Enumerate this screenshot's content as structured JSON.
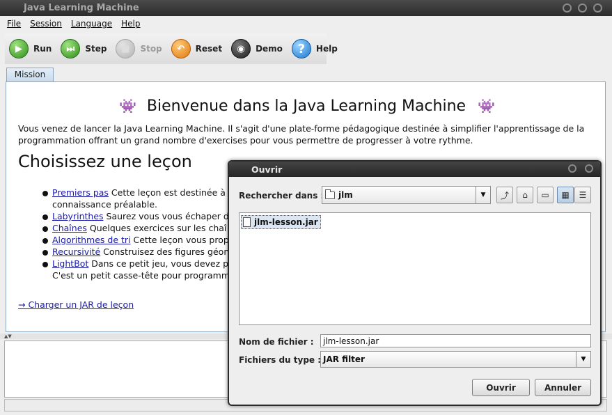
{
  "window": {
    "title": "Java Learning Machine"
  },
  "menu": [
    {
      "label": "File",
      "mnemonic": "F"
    },
    {
      "label": "Session",
      "mnemonic": "S"
    },
    {
      "label": "Language",
      "mnemonic": "L"
    },
    {
      "label": "Help",
      "mnemonic": "H"
    }
  ],
  "toolbar": {
    "run": "Run",
    "step": "Step",
    "stop": "Stop",
    "reset": "Reset",
    "demo": "Demo",
    "help": "Help"
  },
  "tabs": {
    "mission": "Mission"
  },
  "mission": {
    "welcome": "Bienvenue dans la Java Learning Machine",
    "intro": "Vous venez de lancer la Java Learning Machine. Il s'agit d'une plate-forme pédagogique destinée à simplifier l'apprentissage de la programmation offrant un grand nombre d'exercises pour vous permettre de progresser à votre rythme.",
    "choose_title": "Choisissez une leçon",
    "lessons": [
      {
        "link": "Premiers pas",
        "text": " Cette leçon est destinée à g",
        "cont": "connaissance préalable."
      },
      {
        "link": "Labyrinthes",
        "text": " Saurez vous vous échaper d"
      },
      {
        "link": "Chaînes",
        "text": " Quelques exercices sur les chaî"
      },
      {
        "link": "Algorithmes de tri",
        "text": " Cette leçon vous prop"
      },
      {
        "link": "Recursivité",
        "text": " Construisez des figures géon"
      },
      {
        "link": "LightBot",
        "text": " Dans ce petit jeu, vous devez p",
        "cont": "C'est un petit casse-tête pour programm"
      }
    ],
    "load_jar": "→ Charger un JAR de leçon"
  },
  "dialog": {
    "title": "Ouvrir",
    "look_in_label": "Rechercher dans :",
    "look_in_value": "jlm",
    "files": [
      "jlm-lesson.jar"
    ],
    "filename_label": "Nom de fichier :",
    "filename_value": "jlm-lesson.jar",
    "filetype_label": "Fichiers du type :",
    "filetype_value": "JAR filter",
    "open_button": "Ouvrir",
    "cancel_button": "Annuler"
  }
}
